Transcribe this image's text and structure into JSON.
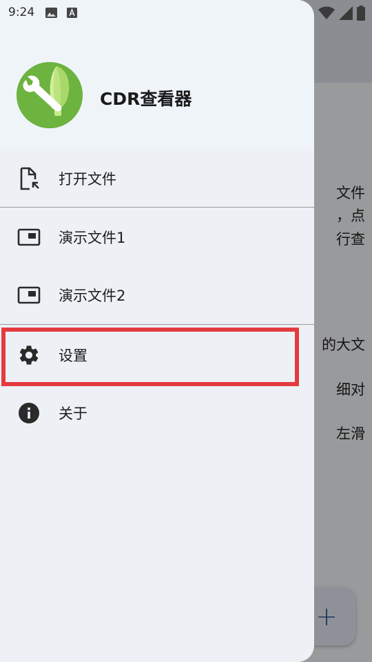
{
  "status_bar": {
    "time": "9:24",
    "icons": [
      "image-icon",
      "text-a-icon",
      "wifi-icon",
      "signal-icon",
      "battery-icon"
    ]
  },
  "background": {
    "text_lines": [
      "文件",
      "，点",
      "行查",
      "的大文",
      "细对",
      "左滑"
    ],
    "fab_label": "+"
  },
  "drawer": {
    "app_name": "CDR查看器",
    "items": [
      {
        "label": "打开文件",
        "icon": "open-file-icon"
      },
      {
        "label": "演示文件1",
        "icon": "presentation-icon"
      },
      {
        "label": "演示文件2",
        "icon": "presentation-icon"
      },
      {
        "label": "设置",
        "icon": "gear-icon"
      },
      {
        "label": "关于",
        "icon": "info-icon"
      }
    ]
  },
  "colors": {
    "highlight": "#e33b3f",
    "logo_green": "#6cb33f",
    "drawer_bg": "#edf1f5",
    "fab_accent": "#2f5c92"
  }
}
